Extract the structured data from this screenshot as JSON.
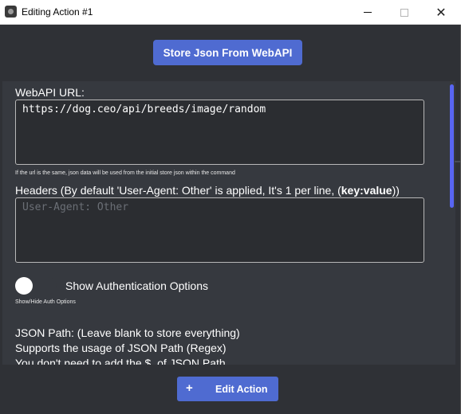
{
  "window": {
    "title": "Editing Action #1",
    "minimize_icon": "minimize-icon",
    "maximize_icon": "maximize-icon",
    "close_icon": "close-icon",
    "close_glyph": "✕"
  },
  "header": {
    "store_button_label": "Store Json From WebAPI"
  },
  "form": {
    "url_label": "WebAPI URL:",
    "url_value": "https://dog.ceo/api/breeds/image/random",
    "url_note": "If the url is the same, json data will be used from the initial store json within the command",
    "headers_label_prefix": "Headers (By default 'User-Agent: Other' is applied, It's 1 per line, (",
    "headers_label_bold": "key:value",
    "headers_label_suffix": "))",
    "headers_placeholder": "User-Agent: Other",
    "auth_toggle_label": "Show Authentication Options",
    "auth_toggle_on": false,
    "auth_note": "Show/Hide Auth Options",
    "json_path_line1": "JSON Path: (Leave blank to store everything)",
    "json_path_line2": "Supports the usage of JSON Path (Regex)",
    "json_path_line3": "You don't need to add the $. of JSON Path"
  },
  "footer": {
    "edit_button_label": "Edit Action",
    "plus_glyph": "+"
  },
  "colors": {
    "accent": "#4f6bd1",
    "background": "#2f3136",
    "panel": "#36393f",
    "scrollbar": "#5865f2"
  }
}
